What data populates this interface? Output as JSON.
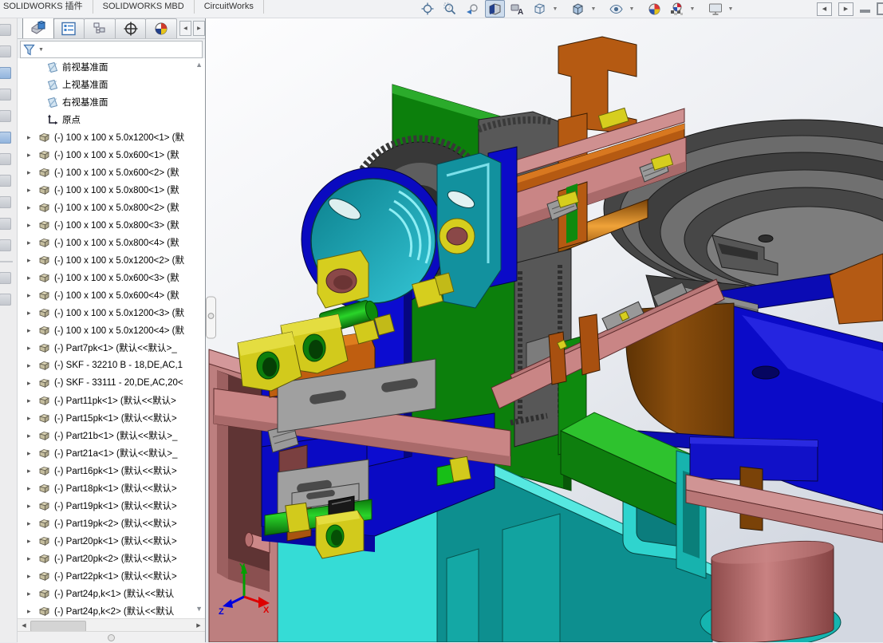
{
  "menubar": {
    "tabs": [
      "SOLIDWORKS 插件",
      "SOLIDWORKS MBD",
      "CircuitWorks"
    ]
  },
  "headsup_toolbar": {
    "icons": [
      "zoom-to-fit",
      "zoom-to-area",
      "previous-view",
      "section-view",
      "hide-show-annotations",
      "view-orientation",
      "display-style",
      "hide-show-items",
      "edit-appearance",
      "apply-scene",
      "view-settings"
    ],
    "pressed": "section-view"
  },
  "window_controls": [
    "collapse-left-pane",
    "collapse-right-pane",
    "minimize",
    "maximize"
  ],
  "feature_panel": {
    "tabs": [
      "featuremanager-design-tree",
      "propertymanager",
      "configurationmanager",
      "dimxpertmanager",
      "displaymanager"
    ],
    "filter": {
      "placeholder": ""
    },
    "tree": {
      "items": [
        {
          "type": "plane",
          "label": "前视基准面"
        },
        {
          "type": "plane",
          "label": "上视基准面"
        },
        {
          "type": "plane",
          "label": "右视基准面"
        },
        {
          "type": "origin",
          "label": "原点"
        },
        {
          "type": "part",
          "label": "(-) 100 x 100 x 5.0x1200<1> (默"
        },
        {
          "type": "part",
          "label": "(-) 100 x 100 x 5.0x600<1> (默"
        },
        {
          "type": "part",
          "label": "(-) 100 x 100 x 5.0x600<2> (默"
        },
        {
          "type": "part",
          "label": "(-) 100 x 100 x 5.0x800<1> (默"
        },
        {
          "type": "part",
          "label": "(-) 100 x 100 x 5.0x800<2> (默"
        },
        {
          "type": "part",
          "label": "(-) 100 x 100 x 5.0x800<3> (默"
        },
        {
          "type": "part",
          "label": "(-) 100 x 100 x 5.0x800<4> (默"
        },
        {
          "type": "part",
          "label": "(-) 100 x 100 x 5.0x1200<2> (默"
        },
        {
          "type": "part",
          "label": "(-) 100 x 100 x 5.0x600<3> (默"
        },
        {
          "type": "part",
          "label": "(-) 100 x 100 x 5.0x600<4> (默"
        },
        {
          "type": "part",
          "label": "(-) 100 x 100 x 5.0x1200<3> (默"
        },
        {
          "type": "part",
          "label": "(-) 100 x 100 x 5.0x1200<4> (默"
        },
        {
          "type": "part",
          "label": "(-) Part7pk<1> (默认<<默认>_"
        },
        {
          "type": "part",
          "label": "(-) SKF - 32210 B - 18,DE,AC,1"
        },
        {
          "type": "part",
          "label": "(-) SKF - 33111 - 20,DE,AC,20<"
        },
        {
          "type": "part",
          "label": "(-) Part11pk<1> (默认<<默认>"
        },
        {
          "type": "part",
          "label": "(-) Part15pk<1> (默认<<默认>"
        },
        {
          "type": "part",
          "label": "(-) Part21b<1> (默认<<默认>_"
        },
        {
          "type": "part",
          "label": "(-) Part21a<1> (默认<<默认>_"
        },
        {
          "type": "part",
          "label": "(-) Part16pk<1> (默认<<默认>"
        },
        {
          "type": "part",
          "label": "(-) Part18pk<1> (默认<<默认>"
        },
        {
          "type": "part",
          "label": "(-) Part19pk<1> (默认<<默认>"
        },
        {
          "type": "part",
          "label": "(-) Part19pk<2> (默认<<默认>"
        },
        {
          "type": "part",
          "label": "(-) Part20pk<1> (默认<<默认>"
        },
        {
          "type": "part",
          "label": "(-) Part20pk<2> (默认<<默认>"
        },
        {
          "type": "part",
          "label": "(-) Part22pk<1> (默认<<默认>"
        },
        {
          "type": "part",
          "label": "(-) Part24p,k<1> (默认<<默认"
        },
        {
          "type": "part",
          "label": "(-) Part24p,k<2> (默认<<默认"
        }
      ]
    }
  },
  "viewport": {
    "triad": {
      "x": "X",
      "y": "Y",
      "z": "Z"
    },
    "colors": {
      "machine_blue": "#0b0bc8",
      "plate_green": "#0c7f0c",
      "bright_green": "#17bf17",
      "cam_teal": "#12919e",
      "part_yellow": "#d6ce1e",
      "copper": "#b55a12",
      "salmon": "#c98585",
      "bowl_grey": "#4a4a4a",
      "table_cyan": "#35dcd6",
      "table_teal": "#0d8f8f",
      "maroon": "#8a4848",
      "triad_x_red": "#dd0000",
      "triad_y_green": "#00a000",
      "triad_z_blue": "#0000dd"
    }
  }
}
